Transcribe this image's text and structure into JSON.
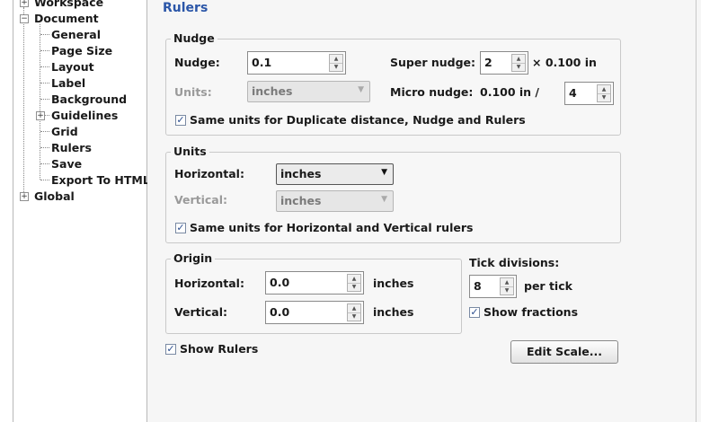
{
  "tree": {
    "workspace": "Workspace",
    "document": "Document",
    "items": [
      "General",
      "Page Size",
      "Layout",
      "Label",
      "Background",
      "Guidelines",
      "Grid",
      "Rulers",
      "Save",
      "Export To HTML"
    ],
    "global": "Global"
  },
  "page_title": "Rulers",
  "nudge": {
    "legend": "Nudge",
    "nudge_label": "Nudge:",
    "nudge_value": "0.1",
    "super_label": "Super nudge:",
    "super_value": "2",
    "super_suffix": "× 0.100 in",
    "units_label": "Units:",
    "units_value": "inches",
    "micro_label": "Micro nudge:",
    "micro_prefix": "0.100 in /",
    "micro_value": "4",
    "same_units_label": "Same units for Duplicate distance, Nudge and Rulers"
  },
  "units": {
    "legend": "Units",
    "horizontal_label": "Horizontal:",
    "horizontal_value": "inches",
    "vertical_label": "Vertical:",
    "vertical_value": "inches",
    "same_units_label": "Same units for Horizontal and Vertical rulers"
  },
  "origin": {
    "legend": "Origin",
    "horizontal_label": "Horizontal:",
    "horizontal_value": "0.0",
    "horizontal_unit": "inches",
    "vertical_label": "Vertical:",
    "vertical_value": "0.0",
    "vertical_unit": "inches"
  },
  "tick": {
    "label": "Tick divisions:",
    "value": "8",
    "suffix": "per tick",
    "show_fractions_label": "Show fractions"
  },
  "show_rulers_label": "Show Rulers",
  "edit_scale_label": "Edit Scale..."
}
